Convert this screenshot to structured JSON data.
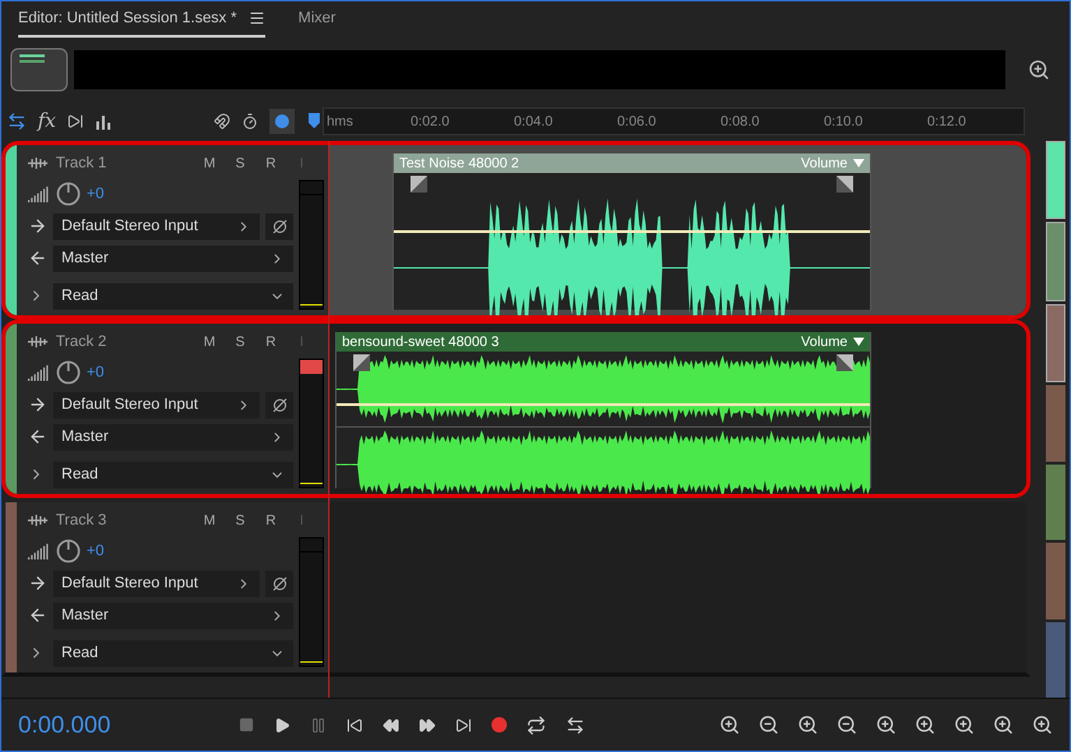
{
  "tabs": [
    {
      "label": "Editor: Untitled Session 1.sesx *",
      "selected": true,
      "menu": true
    },
    {
      "label": "Mixer",
      "selected": false,
      "menu": false
    }
  ],
  "toolbar": {
    "fx_label": "fx"
  },
  "ruler": {
    "labels": [
      "hms",
      "0:02.0",
      "0:04.0",
      "0:06.0",
      "0:08.0",
      "0:10.0",
      "0:12.0"
    ]
  },
  "tracks": [
    {
      "name": "Track 1",
      "color": "#52d59c",
      "selected": true,
      "highlighted": true,
      "buttons": [
        "M",
        "S",
        "R",
        "I"
      ],
      "volume": "+0",
      "input": "Default Stereo Input",
      "output": "Master",
      "automation": "Read",
      "clip_indicator": false,
      "clip": {
        "kind": "speech",
        "title": "Test Noise 48000 2",
        "envelope": "Volume",
        "color": "#55e8ac"
      }
    },
    {
      "name": "Track 2",
      "color": "#5a9a62",
      "selected": false,
      "highlighted": true,
      "buttons": [
        "M",
        "S",
        "R",
        "I"
      ],
      "volume": "+0",
      "input": "Default Stereo Input",
      "output": "Master",
      "automation": "Read",
      "clip_indicator": true,
      "clip": {
        "kind": "music",
        "title": "bensound-sweet 48000 3",
        "envelope": "Volume",
        "color": "#4be84b"
      }
    },
    {
      "name": "Track 3",
      "color": "#7f5a50",
      "selected": false,
      "highlighted": false,
      "buttons": [
        "M",
        "S",
        "R",
        "I"
      ],
      "volume": "+0",
      "input": "Default Stereo Input",
      "output": "Master",
      "automation": "Read",
      "clip_indicator": false
    }
  ],
  "overview_strip": [
    {
      "color": "#5ee3a8",
      "selected": true
    },
    {
      "color": "#6a8f6a",
      "selected": true
    },
    {
      "color": "#8a6a62",
      "selected": true
    },
    {
      "color": "#7a5a4a",
      "selected": false
    },
    {
      "color": "#5f7f4f",
      "selected": false
    },
    {
      "color": "#7a5a4a",
      "selected": false
    },
    {
      "color": "#4a5a7a",
      "selected": false
    }
  ],
  "transport": {
    "time": "0:00.000"
  }
}
